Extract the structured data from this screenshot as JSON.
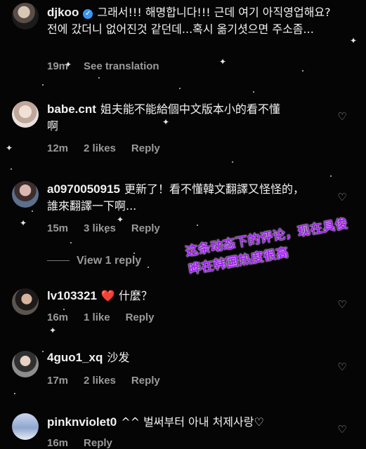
{
  "comments": [
    {
      "username": "djkoo",
      "verified": true,
      "text": "그래서!!! 해명합니다!!! 근데 여기 아직영업해요? 전에 갔더니 없어진것 같던데...혹시 옮기셧으면 주소좀...",
      "time": "19m",
      "see_translation": "See translation"
    },
    {
      "username": "babe.cnt",
      "text": "姐夫能不能給個中文版本小的看不懂啊",
      "time": "12m",
      "likes": "2 likes",
      "reply": "Reply"
    },
    {
      "username": "a0970050915",
      "text": "更新了！看不懂韓文翻譯又怪怪的，誰來翻譯一下啊...",
      "time": "15m",
      "likes": "3 likes",
      "reply": "Reply",
      "view_replies": "View 1 reply"
    },
    {
      "username": "lv103321",
      "text_suffix": " 什麼？",
      "emoji": "❤️",
      "time": "16m",
      "likes": "1 like",
      "reply": "Reply"
    },
    {
      "username": "4guo1_xq",
      "text": "沙发",
      "time": "17m",
      "likes": "2 likes",
      "reply": "Reply"
    },
    {
      "username": "pinknviolet0",
      "text": "^^ 벌써부터 아내 처제사랑♡",
      "time": "16m",
      "reply": "Reply"
    }
  ],
  "overlay_caption": "这条动态下的评论，现在具俊晔在韩国热度很高",
  "colors": {
    "background": "#050505",
    "meta_text": "#9a9a9a",
    "overlay": "#a020f0",
    "verified_badge": "#3897f0"
  },
  "icons": {
    "like": "heart-outline-icon",
    "verified": "verified-badge-icon"
  }
}
